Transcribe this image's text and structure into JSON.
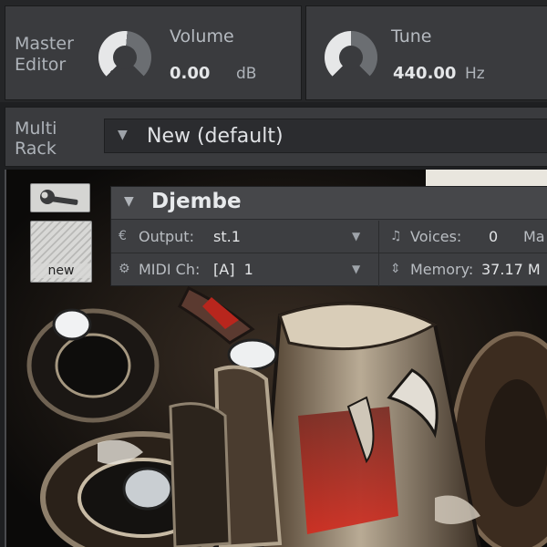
{
  "master": {
    "title": "Master\nEditor",
    "volume": {
      "label": "Volume",
      "value": "0.00",
      "unit": "dB"
    },
    "tune": {
      "label": "Tune",
      "value": "440.00",
      "unit": "Hz"
    }
  },
  "rack": {
    "label": "Multi\nRack",
    "name": "New (default)"
  },
  "side_buttons": {
    "new_label": "new"
  },
  "instrument": {
    "name": "Djembe",
    "output_label": "Output:",
    "output_value": "st.1",
    "midi_label": "MIDI Ch:",
    "midi_value": "[A]  1",
    "voices_label": "Voices:",
    "voices_value": "0",
    "voices_max_label": "Ma",
    "memory_label": "Memory:",
    "memory_value": "37.17 M"
  },
  "icons": {
    "volume_knob": "knob-icon",
    "tune_knob": "knob-icon",
    "wrench": "wrench-icon",
    "output": "output-icon",
    "midi": "midi-icon",
    "voices": "voices-icon",
    "memory": "memory-icon"
  }
}
